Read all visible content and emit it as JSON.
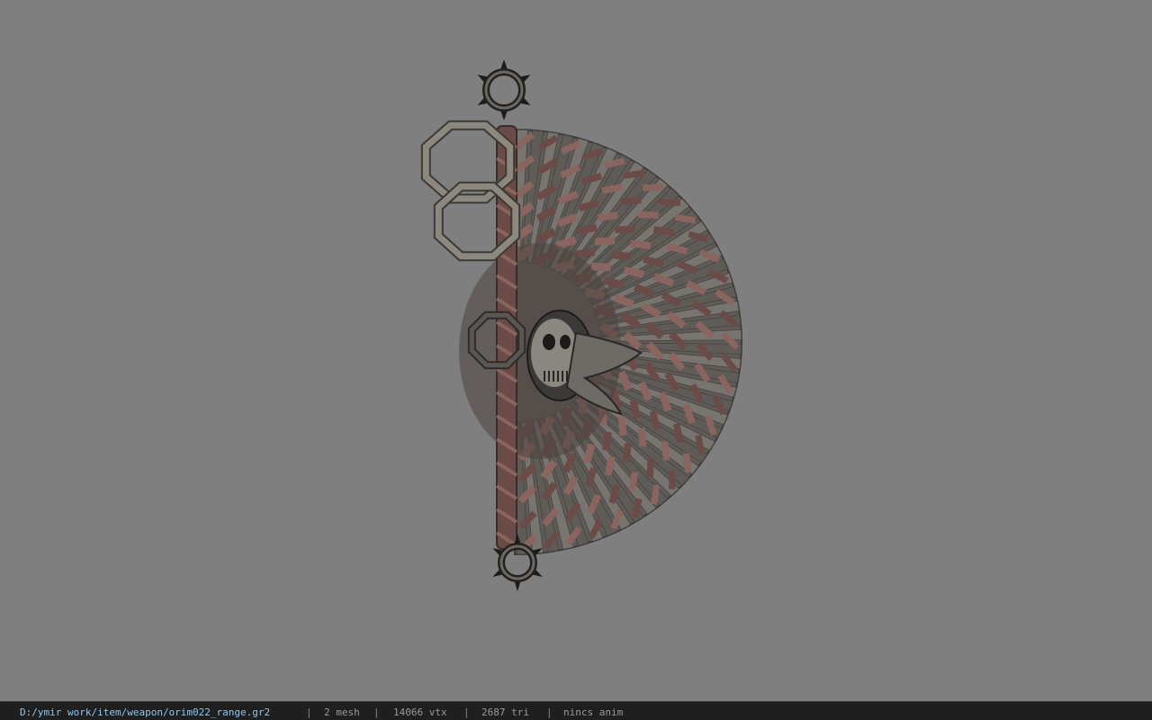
{
  "viewer": {
    "background_color": "#7f7f7f",
    "model_colors": {
      "wood": "#5f5c58",
      "wood_light": "#7a7672",
      "strap": "#6b4b47",
      "strap_light": "#8a6560",
      "metal": "#8c8880",
      "dark": "#2a2826"
    }
  },
  "status_bar": {
    "file_path": "D:/ymir work/item/weapon/orim022_range.gr2",
    "separator": "|",
    "mesh_count": "2 mesh",
    "vertex_count": "14066 vtx",
    "triangle_count": "2687 tri",
    "anim_status": "nincs anim"
  }
}
